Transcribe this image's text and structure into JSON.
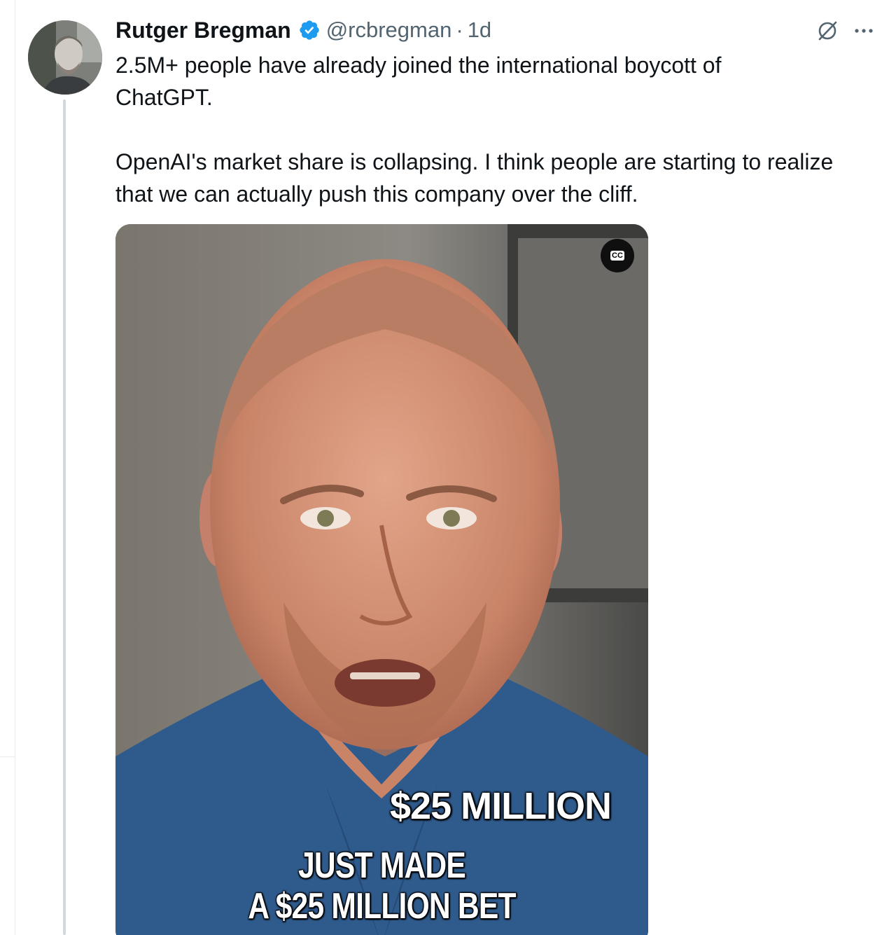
{
  "tweet": {
    "author_name": "Rutger Bregman",
    "handle": "@rcbregman",
    "separator": "·",
    "time": "1d",
    "text_paragraph_1_line_1": "2.5M+ people have already joined the international boycott of",
    "text_paragraph_1_line_2": "ChatGPT.",
    "text_paragraph_2_line_1": "OpenAI's market share is collapsing. I think people are starting to realize",
    "text_paragraph_2_line_2": "that we can actually push this company over the cliff.",
    "verified_color": "#1d9bf0"
  },
  "media": {
    "cc_label": "CC",
    "caption_amount": "$25 MILLION",
    "caption_line_1": "JUST MADE",
    "caption_line_2": "A $25 MILLION BET"
  },
  "icons": {
    "verified": "verified-badge-icon",
    "grok": "grok-icon",
    "more": "more-options-icon",
    "captions": "closed-captions-icon"
  }
}
